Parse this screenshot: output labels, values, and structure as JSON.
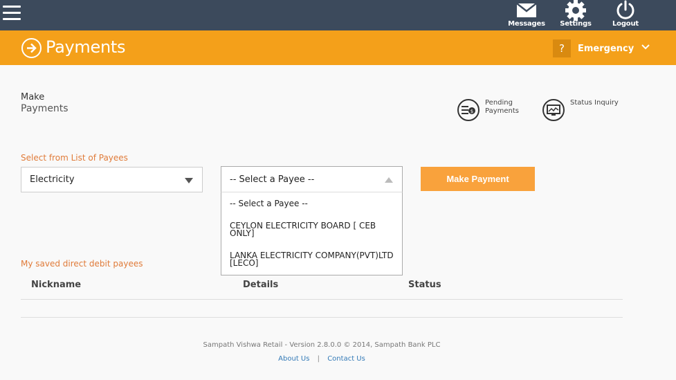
{
  "topbar": {
    "messages_label": "Messages",
    "settings_label": "Settings",
    "logout_label": "Logout"
  },
  "header": {
    "title": "Payments",
    "help": "?",
    "emergency_label": "Emergency"
  },
  "page": {
    "heading_line1": "Make",
    "heading_line2": "Payments",
    "quick_links": {
      "pending_line1": "Pending",
      "pending_line2": "Payments",
      "status_inquiry": "Status Inquiry"
    }
  },
  "payee_form": {
    "label": "Select from List of Payees",
    "category_value": "Electricity",
    "payee_value": "-- Select a Payee --",
    "payee_options": [
      "-- Select a Payee --",
      "CEYLON ELECTRICITY BOARD [ CEB ONLY]",
      "LANKA ELECTRICITY COMPANY(PVT)LTD [LECO]"
    ],
    "make_payment_label": "Make Payment"
  },
  "saved_payees": {
    "label": "My saved direct debit payees",
    "columns": [
      "Nickname",
      "Details",
      "Status"
    ]
  },
  "footer": {
    "copyright": "Sampath Vishwa Retail - Version 2.8.0.0 © 2014, Sampath Bank PLC",
    "about": "About Us",
    "separator": "|",
    "contact": "Contact Us"
  },
  "colors": {
    "topbar": "#3c4a5c",
    "accent": "#f4a01a",
    "button": "#f9a23c",
    "label_orange": "#e07b39"
  }
}
